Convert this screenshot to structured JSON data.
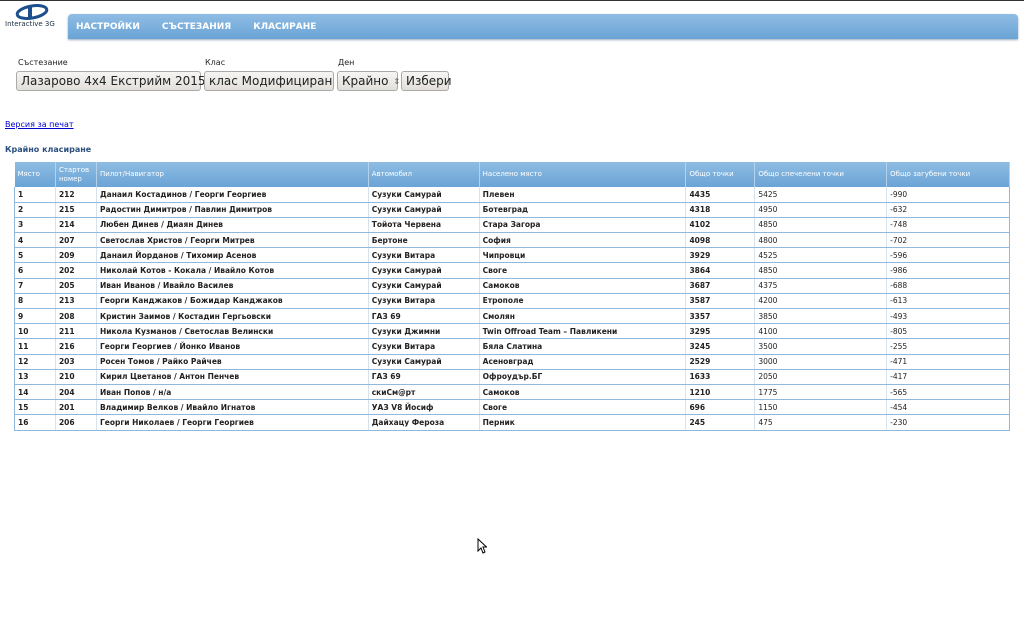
{
  "logo": {
    "text": "Interactive 3G"
  },
  "nav": [
    "НАСТРОЙКИ",
    "СЪСТЕЗАНИЯ",
    "КЛАСИРАНЕ"
  ],
  "filters": {
    "competition": {
      "label": "Състезание",
      "value": "Лазарово 4x4 Екстрийм 2015"
    },
    "class": {
      "label": "Клас",
      "value": "клас Модифициран"
    },
    "day": {
      "label": "Ден",
      "value": "Крайно"
    },
    "submit": "Избери"
  },
  "print_link": "Версия за печат",
  "section_title": "Крайно класиране",
  "table": {
    "headers": [
      "Място",
      "Стартов номер",
      "Пилот/Навигатор",
      "Автомобил",
      "Населено място",
      "Общо точки",
      "Общо спечелени точки",
      "Общо загубени точки"
    ],
    "rows": [
      [
        "1",
        "212",
        "Данаил Костадинов / Георги Георгиев",
        "Сузуки Самурай",
        "Плевен",
        "4435",
        "5425",
        "-990"
      ],
      [
        "2",
        "215",
        "Радостин Димитров / Павлин Димитров",
        "Сузуки Самурай",
        "Ботевград",
        "4318",
        "4950",
        "-632"
      ],
      [
        "3",
        "214",
        "Любен Динев / Диаян Динев",
        "Тойота Червена",
        "Стара Загора",
        "4102",
        "4850",
        "-748"
      ],
      [
        "4",
        "207",
        "Светослав Христов / Георги Митрев",
        "Бертоне",
        "София",
        "4098",
        "4800",
        "-702"
      ],
      [
        "5",
        "209",
        "Данаил Йорданов / Тихомир Асенов",
        "Сузуки Витара",
        "Чипровци",
        "3929",
        "4525",
        "-596"
      ],
      [
        "6",
        "202",
        "Николай Котов - Кокала / Ивайло Котов",
        "Сузуки Самурай",
        "Своге",
        "3864",
        "4850",
        "-986"
      ],
      [
        "7",
        "205",
        "Иван Иванов / Ивайло Василев",
        "Сузуки Самурай",
        "Самоков",
        "3687",
        "4375",
        "-688"
      ],
      [
        "8",
        "213",
        "Георги Канджаков / Божидар Канджаков",
        "Сузуки Витара",
        "Етрополе",
        "3587",
        "4200",
        "-613"
      ],
      [
        "9",
        "208",
        "Кристин Заимов / Костадин Гергьовски",
        "ГАЗ 69",
        "Смолян",
        "3357",
        "3850",
        "-493"
      ],
      [
        "10",
        "211",
        "Никола Кузманов / Светослав Велински",
        "Сузуки Джимни",
        "Twin Offroad Team – Павликени",
        "3295",
        "4100",
        "-805"
      ],
      [
        "11",
        "216",
        "Георги Георгиев / Йонко Иванов",
        "Сузуки Витара",
        "Бяла Слатина",
        "3245",
        "3500",
        "-255"
      ],
      [
        "12",
        "203",
        "Росен Томов / Райко Райчев",
        "Сузуки Самурай",
        "Асеновград",
        "2529",
        "3000",
        "-471"
      ],
      [
        "13",
        "210",
        "Кирил Цветанов / Антон Пенчев",
        "ГАЗ 69",
        "Офроудър.БГ",
        "1633",
        "2050",
        "-417"
      ],
      [
        "14",
        "204",
        "Иван Попов / н/а",
        "скиСм@рт",
        "Самоков",
        "1210",
        "1775",
        "-565"
      ],
      [
        "15",
        "201",
        "Владимир Велков / Ивайло Игнатов",
        "УАЗ V8 Йосиф",
        "Своге",
        "696",
        "1150",
        "-454"
      ],
      [
        "16",
        "206",
        "Георги Николаев / Георги Георгиев",
        "Дайхацу Фероза",
        "Перник",
        "245",
        "475",
        "-230"
      ]
    ]
  }
}
